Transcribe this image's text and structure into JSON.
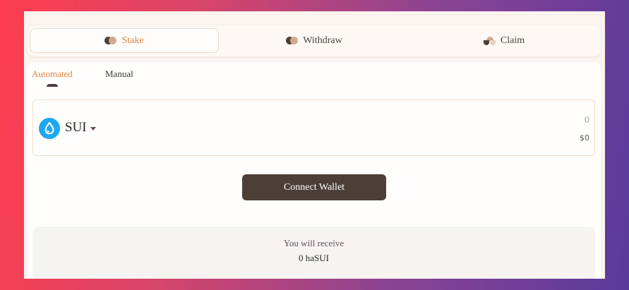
{
  "tabs": [
    {
      "label": "Stake",
      "icon": "stake-icon",
      "active": true
    },
    {
      "label": "Withdraw",
      "icon": "withdraw-icon",
      "active": false
    },
    {
      "label": "Claim",
      "icon": "claim-icon",
      "active": false
    }
  ],
  "modes": [
    {
      "label": "Automated",
      "active": true
    },
    {
      "label": "Manual",
      "active": false
    }
  ],
  "input": {
    "token": "SUI",
    "token_icon": "sui-droplet-icon",
    "amount": "0",
    "usd_value": "$0"
  },
  "connect_button": {
    "label": "Connect Wallet"
  },
  "receive": {
    "label": "You will receive",
    "value": "0 haSUI"
  },
  "colors": {
    "accent": "#e0823a",
    "button_bg": "#4b3f38",
    "sui_blue": "#1da8f0"
  }
}
